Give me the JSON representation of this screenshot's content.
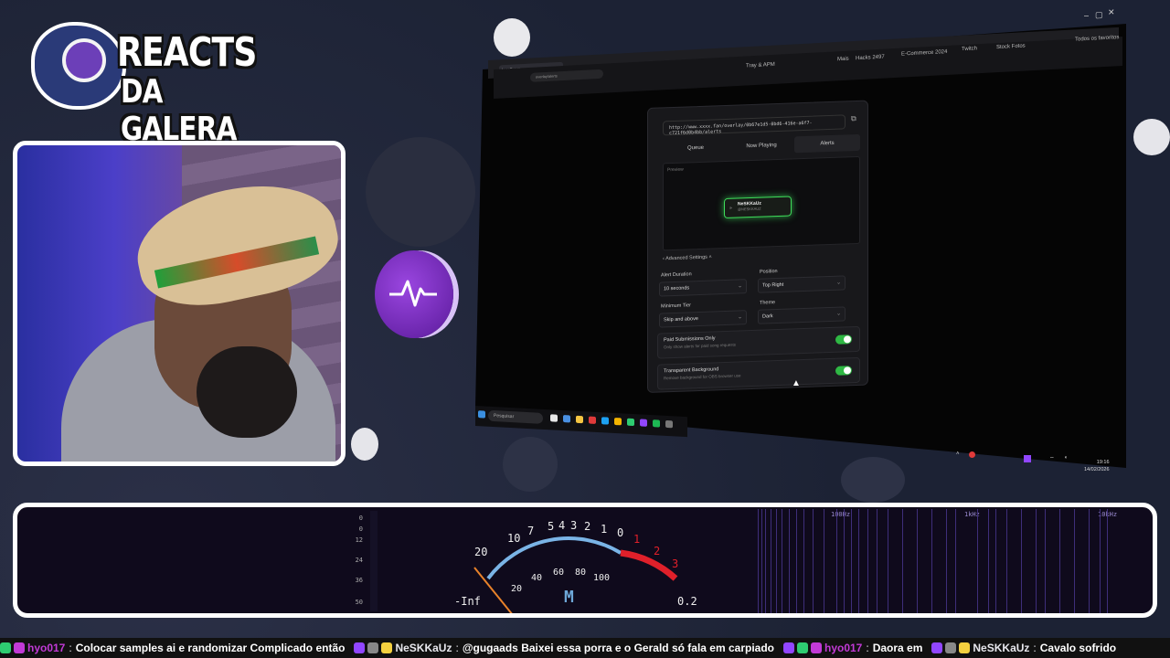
{
  "overlay": {
    "logo_line1": "REACTS",
    "logo_line2": "DA GALERA"
  },
  "browser": {
    "tab_title": "localhost",
    "address": "overlay/alerts",
    "bookmarks": [
      "Tray & APM",
      "Mais",
      "Hacks 2497",
      "E-Commerce 2024",
      "Twitch",
      "Stock Fotos",
      "Todos os favoritos"
    ],
    "window_controls": [
      "–",
      "▢",
      "✕"
    ]
  },
  "panel": {
    "url": "http://www.xxxx.fan/overlay/0b67e1d5-0bd6-416e-a6f7-c721f6d0b4bb/alerts",
    "tabs": [
      {
        "label": "Queue",
        "active": false
      },
      {
        "label": "Now Playing",
        "active": false
      },
      {
        "label": "Alerts",
        "active": true
      }
    ],
    "preview_label": "Preview",
    "alert_name": "NeSKKaUz",
    "alert_sub": "@NESKKAUZ",
    "advanced_label": "Advanced Settings",
    "fields": {
      "alert_duration": {
        "label": "Alert Duration",
        "value": "10 seconds"
      },
      "position": {
        "label": "Position",
        "value": "Top Right"
      },
      "minimum_tier": {
        "label": "Minimum Tier",
        "value": "Skip and above"
      },
      "theme": {
        "label": "Theme",
        "value": "Dark"
      }
    },
    "toggles": [
      {
        "title": "Paid Submissions Only",
        "desc": "Only show alerts for paid song requests",
        "on": true
      },
      {
        "title": "Transparent Background",
        "desc": "Remove background for OBS browser use",
        "on": true
      }
    ]
  },
  "taskbar": {
    "search_placeholder": "Pesquisar",
    "time": "19:16",
    "date": "14/02/2026"
  },
  "audio": {
    "db_scale": [
      "0",
      "0",
      "12",
      "24",
      "36",
      "50"
    ],
    "vu_ticks": [
      "20",
      "10",
      "7",
      "5",
      "4",
      "3",
      "2",
      "1",
      "0",
      "1",
      "2",
      "3"
    ],
    "vu_inner_ticks": [
      "20",
      "40",
      "60",
      "80",
      "100"
    ],
    "left_readout": "-Inf",
    "mode_label": "M",
    "right_readout": "0.2",
    "freq_labels": [
      "100Hz",
      "1kHz",
      "10kHz"
    ]
  },
  "ticker": [
    {
      "user": "hyo017",
      "user_color": "#c23ad6",
      "message": "Colocar samples ai e randomizar  Complicado então"
    },
    {
      "user": "NeSKKaUz",
      "user_color": "#ffffff",
      "message": "@gugaads Baixei essa porra e o Gerald só fala em carpiado"
    },
    {
      "user": "hyo017",
      "user_color": "#c23ad6",
      "message": "Daora em"
    },
    {
      "user": "NeSKKaUz",
      "user_color": "#ffffff",
      "message": "Cavalo sofrido"
    }
  ],
  "colors": {
    "accent_green": "#2fb844",
    "vu_red": "#e0202a",
    "vu_blue": "#7ab4e6",
    "twitch_purple": "#9146ff"
  }
}
